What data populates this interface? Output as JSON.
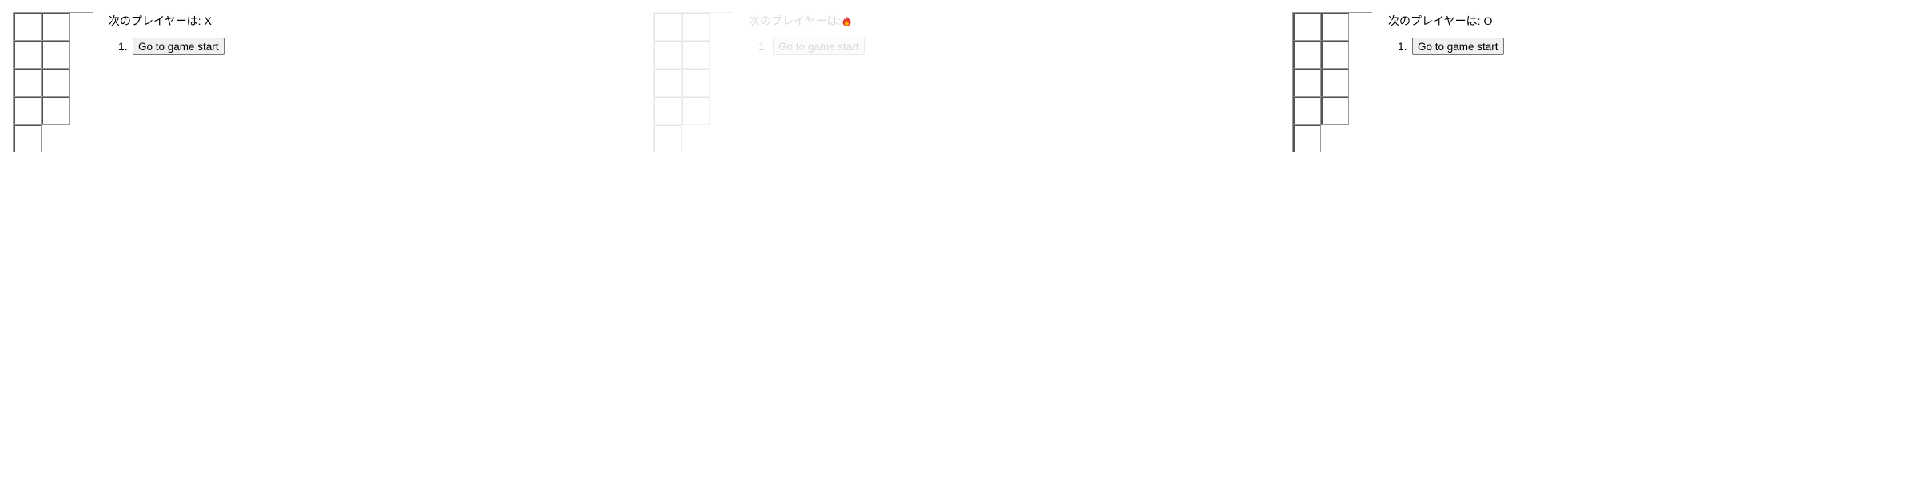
{
  "games": [
    {
      "status_label": "次のプレイヤーは:",
      "status_value": "X",
      "moves": [
        {
          "number": "1.",
          "label": "Go to game start"
        }
      ]
    },
    {
      "status_label": "次のプレイヤーは:",
      "status_value": "",
      "status_icon": "fire-icon",
      "moves": [
        {
          "number": "1.",
          "label": "Go to game start"
        }
      ]
    },
    {
      "status_label": "次のプレイヤーは:",
      "status_value": "O",
      "moves": [
        {
          "number": "1.",
          "label": "Go to game start"
        }
      ]
    }
  ],
  "colors": {
    "grid": "#999999",
    "fire_outer": "#e53935",
    "fire_inner": "#ffb300"
  }
}
